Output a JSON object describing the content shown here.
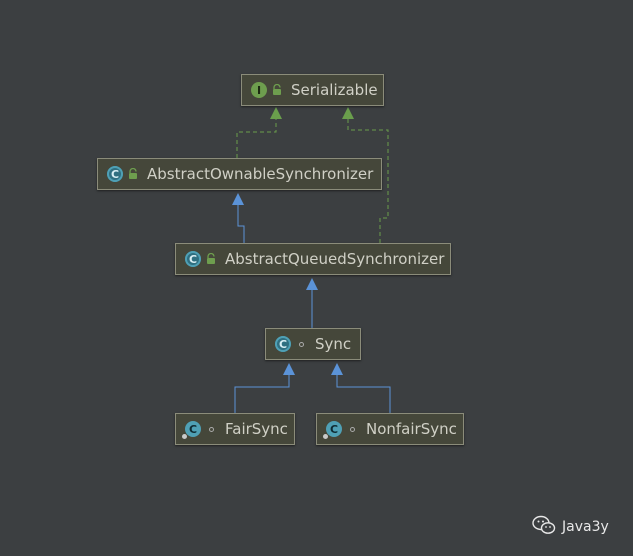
{
  "nodes": {
    "serializable": {
      "label": "Serializable",
      "kind": "interface",
      "kind_letter": "I"
    },
    "aos": {
      "label": "AbstractOwnableSynchronizer",
      "kind": "abstract-class",
      "kind_letter": "C"
    },
    "aqs": {
      "label": "AbstractQueuedSynchronizer",
      "kind": "abstract-class",
      "kind_letter": "C"
    },
    "sync": {
      "label": "Sync",
      "kind": "abstract-class",
      "kind_letter": "C"
    },
    "fairsync": {
      "label": "FairSync",
      "kind": "class",
      "kind_letter": "C"
    },
    "nonfairsync": {
      "label": "NonfairSync",
      "kind": "class",
      "kind_letter": "C"
    }
  },
  "edges": [
    {
      "from": "aos",
      "to": "serializable",
      "type": "implements"
    },
    {
      "from": "aqs",
      "to": "serializable",
      "type": "implements"
    },
    {
      "from": "aqs",
      "to": "aos",
      "type": "extends"
    },
    {
      "from": "sync",
      "to": "aqs",
      "type": "extends"
    },
    {
      "from": "fairsync",
      "to": "sync",
      "type": "extends"
    },
    {
      "from": "nonfairsync",
      "to": "sync",
      "type": "extends"
    }
  ],
  "colors": {
    "background": "#3c3f41",
    "implements_arrow": "#6a9e4c",
    "extends_arrow": "#5b93d8",
    "node_fill": "#45473a",
    "node_border": "#8b8c7a"
  },
  "watermark": {
    "text": "Java3y",
    "icon": "wechat-icon"
  }
}
